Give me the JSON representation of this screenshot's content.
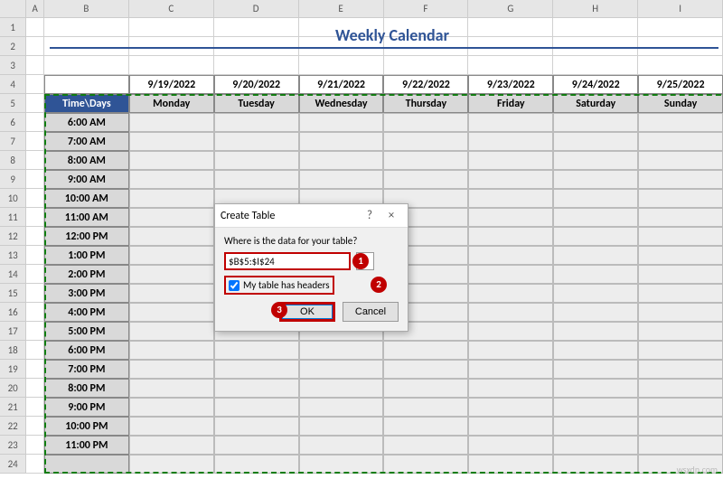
{
  "columns": [
    "A",
    "B",
    "C",
    "D",
    "E",
    "F",
    "G",
    "H",
    "I"
  ],
  "title": "Weekly Calendar",
  "dates": [
    "9/19/2022",
    "9/20/2022",
    "9/21/2022",
    "9/22/2022",
    "9/23/2022",
    "9/24/2022",
    "9/25/2022"
  ],
  "cornerLabel": "Time\\Days",
  "days": [
    "Monday",
    "Tuesday",
    "Wednesday",
    "Thursday",
    "Friday",
    "Saturday",
    "Sunday"
  ],
  "times": [
    "6:00 AM",
    "7:00 AM",
    "8:00 AM",
    "9:00 AM",
    "10:00 AM",
    "11:00 AM",
    "12:00 PM",
    "1:00 PM",
    "2:00 PM",
    "3:00 PM",
    "4:00 PM",
    "5:00 PM",
    "6:00 PM",
    "7:00 PM",
    "8:00 PM",
    "9:00 PM",
    "10:00 PM",
    "11:00 PM"
  ],
  "rowNumbers": [
    "1",
    "2",
    "3",
    "4",
    "5",
    "6",
    "7",
    "8",
    "9",
    "10",
    "11",
    "12",
    "13",
    "14",
    "15",
    "16",
    "17",
    "18",
    "19",
    "20",
    "21",
    "22",
    "23",
    "24"
  ],
  "dialog": {
    "title": "Create Table",
    "help": "?",
    "close": "×",
    "prompt": "Where is the data for your table?",
    "range": "$B$5:$I$24",
    "rangeBtn": "↥",
    "checkboxChecked": true,
    "checkboxLabel": "My table has headers",
    "ok": "OK",
    "cancel": "Cancel"
  },
  "badges": {
    "b1": "1",
    "b2": "2",
    "b3": "3"
  },
  "watermark": "wsxdn.com"
}
